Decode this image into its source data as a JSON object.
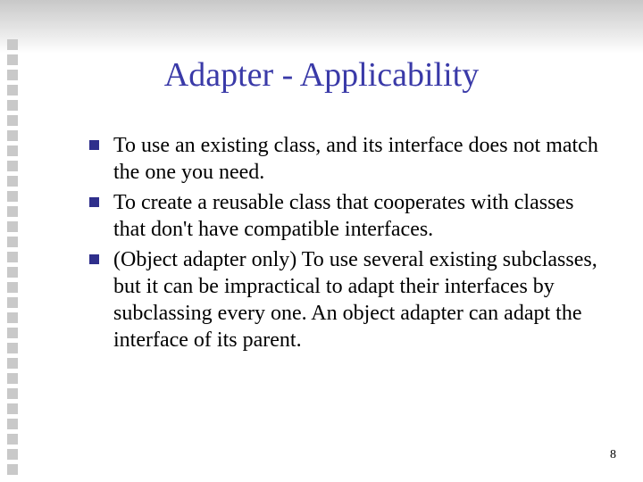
{
  "title": "Adapter - Applicability",
  "bullets": [
    "To use an existing class, and its interface does not match the one you need.",
    "To create a reusable class that cooperates with classes that don't have compatible interfaces.",
    "(Object adapter only) To use several existing subclasses, but it can be impractical to adapt their interfaces by subclassing every one.  An object adapter can adapt the interface of its parent."
  ],
  "page_number": "8",
  "side_square_count": 29
}
